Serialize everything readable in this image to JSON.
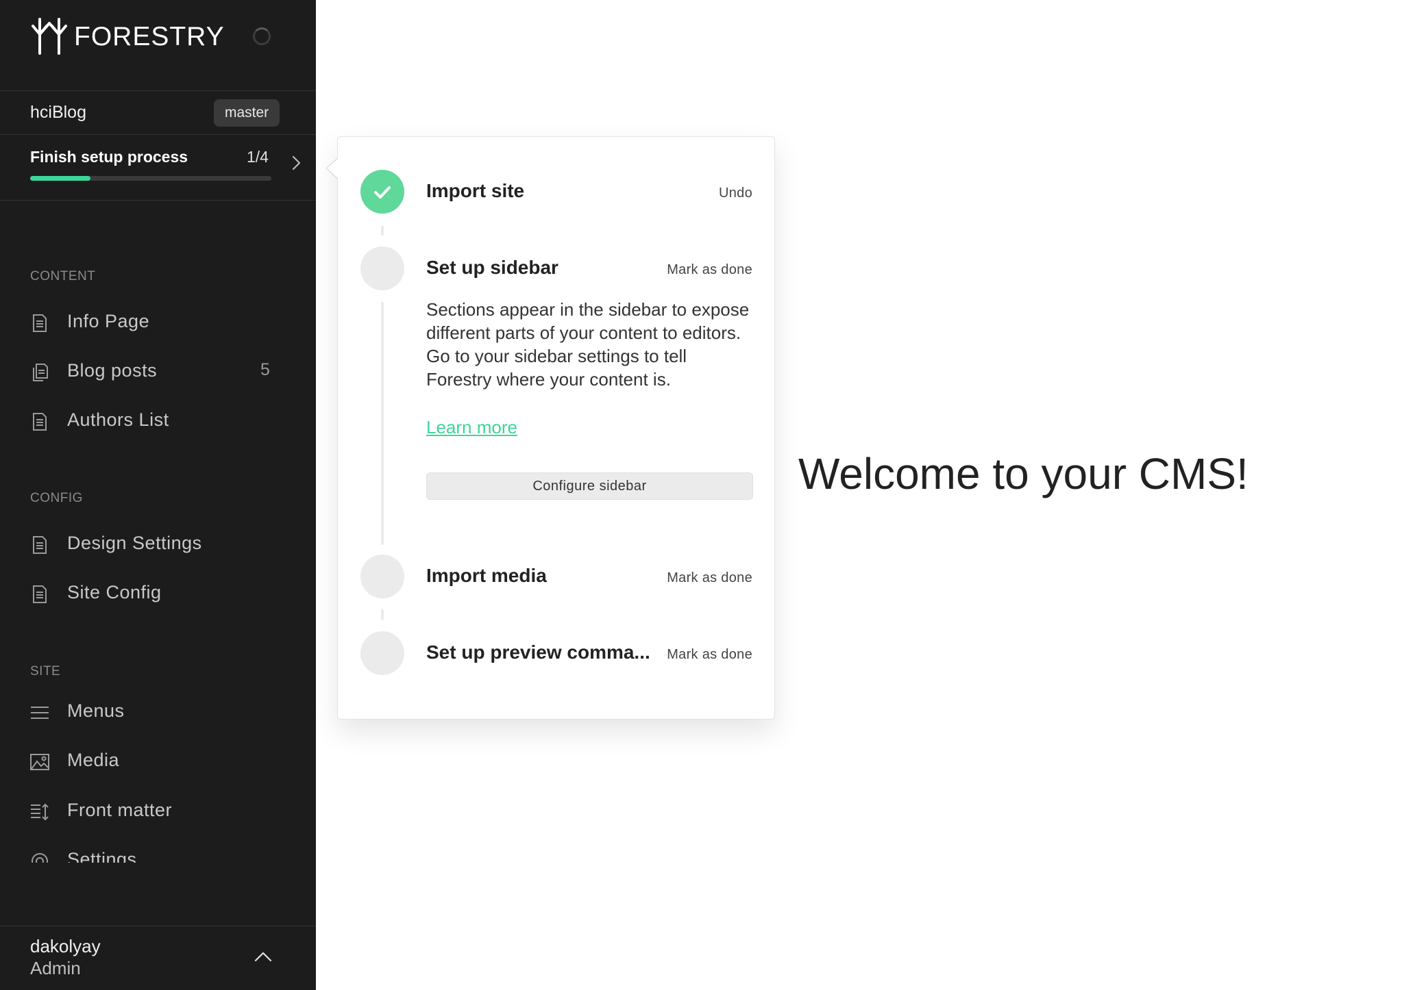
{
  "brand": {
    "name": "FORESTRY"
  },
  "site": {
    "name": "hciBlog",
    "branch": "master"
  },
  "setup": {
    "title": "Finish setup process",
    "count": "1/4",
    "progress_fraction": 0.25
  },
  "sidebar": {
    "sections": [
      {
        "label": "CONTENT",
        "items": [
          {
            "label": "Info Page",
            "icon": "document-icon"
          },
          {
            "label": "Blog posts",
            "icon": "documents-icon",
            "count": "5"
          },
          {
            "label": "Authors List",
            "icon": "document-icon"
          }
        ]
      },
      {
        "label": "CONFIG",
        "items": [
          {
            "label": "Design Settings",
            "icon": "document-icon"
          },
          {
            "label": "Site Config",
            "icon": "document-icon"
          }
        ]
      },
      {
        "label": "SITE",
        "items": [
          {
            "label": "Menus",
            "icon": "menu-icon"
          },
          {
            "label": "Media",
            "icon": "image-icon"
          },
          {
            "label": "Front matter",
            "icon": "front-matter-icon"
          },
          {
            "label": "Settings",
            "icon": "gear-icon"
          }
        ]
      }
    ]
  },
  "user": {
    "name": "dakolyay",
    "role": "Admin"
  },
  "popover": {
    "steps": [
      {
        "title": "Import site",
        "action": "Undo",
        "done": true
      },
      {
        "title": "Set up sidebar",
        "action": "Mark as done",
        "done": false,
        "description": "Sections appear in the sidebar to expose different parts of your content to editors. Go to your sidebar settings to tell Forestry where your content is.",
        "link": "Learn more",
        "button": "Configure sidebar"
      },
      {
        "title": "Import media",
        "action": "Mark as done",
        "done": false
      },
      {
        "title": "Set up preview comma...",
        "action": "Mark as done",
        "done": false
      }
    ]
  },
  "main": {
    "welcome": "Welcome to your CMS!"
  },
  "colors": {
    "sidebar_bg": "#1c1c1c",
    "accent": "#3ed59a",
    "done_circle": "#5fd89a"
  }
}
